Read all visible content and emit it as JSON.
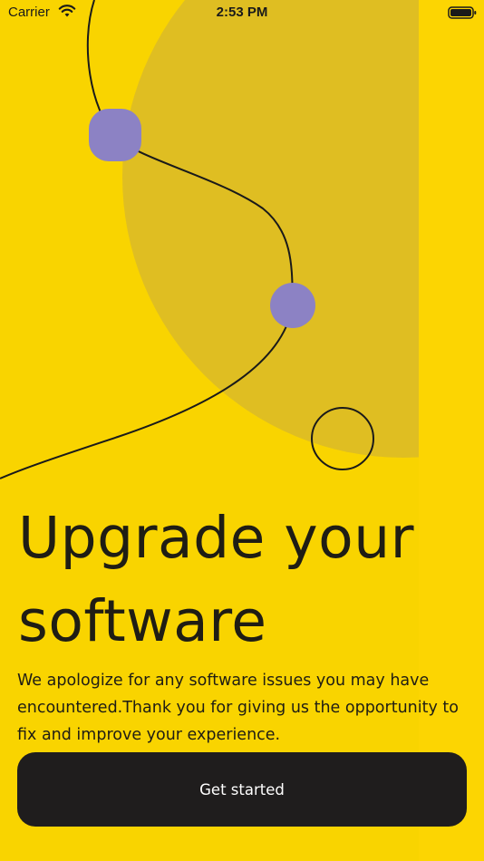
{
  "status_bar": {
    "carrier": "Carrier",
    "time": "2:53 PM",
    "icons": [
      "wifi-icon",
      "battery-icon"
    ]
  },
  "hero": {
    "title": "Upgrade your software",
    "description": "We apologize for any software issues you may have encountered.Thank you for giving us the opportunity to fix and improve your experience."
  },
  "actions": {
    "get_started_label": "Get started"
  },
  "colors": {
    "background": "#FCD502",
    "blob": "#DFBE22",
    "dot": "#8C82C4",
    "button": "#1F1D1D",
    "text": "#1F1D14"
  }
}
